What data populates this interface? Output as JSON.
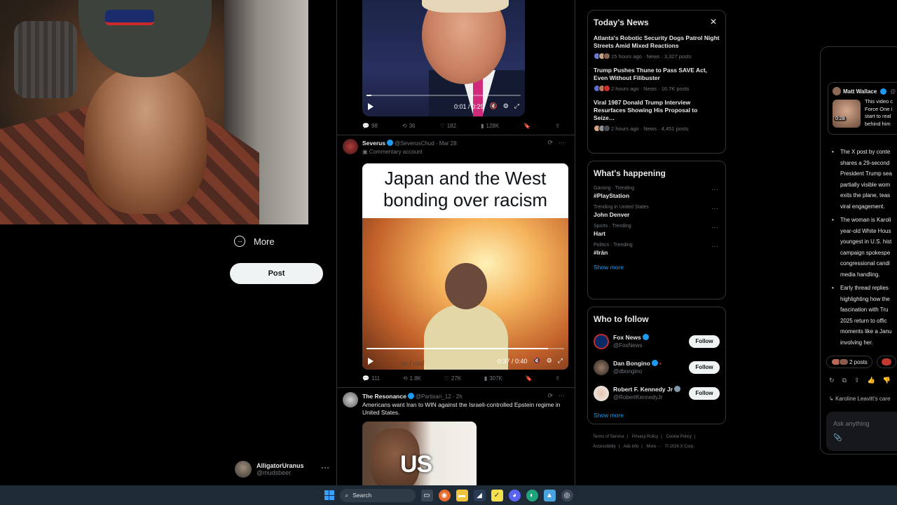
{
  "nav": {
    "more_label": "More",
    "post_label": "Post",
    "account_name": "AlligatorUranus",
    "account_handle": "@mudsbeer"
  },
  "tweet1": {
    "video_time": "0:01 / 0:29",
    "progress": 0.03,
    "replies": "98",
    "reposts": "36",
    "likes": "182",
    "views": "128K"
  },
  "tweet2": {
    "name": "Severus",
    "handle": "@SeverusChud",
    "date": "Mar 28",
    "account_type": "Commentary account",
    "caption": "Japan and the West bonding over racism",
    "subtitle_partial": "no I conf",
    "video_time": "0:37 / 0:40",
    "progress": 0.92,
    "replies": "111",
    "reposts": "1.8K",
    "likes": "27K",
    "views": "307K"
  },
  "tweet3": {
    "name": "The Resonance",
    "handle": "@Partisan_12",
    "date": "2h",
    "text": "Americans want Iran to WIN against the Israeli-controlled Epstein regime in United States.",
    "image_text": "US"
  },
  "todays_news": {
    "title": "Today's News",
    "items": [
      {
        "title": "Atlanta's Robotic Security Dogs Patrol Night Streets Amid Mixed Reactions",
        "meta": "15 hours ago · News · 3,327 posts"
      },
      {
        "title": "Trump Pushes Thune to Pass SAVE Act, Even Without Filibuster",
        "meta": "2 hours ago · News · 16.7K posts"
      },
      {
        "title": "Viral 1987 Donald Trump Interview Resurfaces Showing His Proposal to Seize…",
        "meta": "2 hours ago · News · 4,451 posts"
      }
    ]
  },
  "whats_happening": {
    "title": "What's happening",
    "trends": [
      {
        "context": "Gaming · Trending",
        "name": "#PlayStation"
      },
      {
        "context": "Trending in United States",
        "name": "John Denver"
      },
      {
        "context": "Sports · Trending",
        "name": "Hart"
      },
      {
        "context": "Politics · Trending",
        "name": "#Irán"
      }
    ],
    "show_more": "Show more"
  },
  "who_to_follow": {
    "title": "Who to follow",
    "accounts": [
      {
        "name": "Fox News",
        "handle": "@FoxNews",
        "button": "Follow"
      },
      {
        "name": "Dan Bongino",
        "handle": "@dbongino",
        "button": "Follow"
      },
      {
        "name": "Robert F. Kennedy Jr",
        "handle": "@RobertKennedyJr",
        "button": "Follow"
      }
    ],
    "show_more": "Show more"
  },
  "footer": {
    "links": [
      "Terms of Service",
      "|",
      "Privacy Policy",
      "|",
      "Cookie Policy",
      "|",
      "Accessibility",
      "|",
      "Ads info",
      "|",
      "More ···",
      "© 2026 X Corp."
    ]
  },
  "grok": {
    "quote_name": "Matt Wallace",
    "quote_handle": "@",
    "quote_duration": "0:28",
    "quote_text": [
      "This video c",
      "Force One i",
      "start to real",
      "behind him"
    ],
    "bullets": [
      [
        "The X post by conte",
        "shares a 29-second",
        "President Trump sea",
        "partially visible wom",
        "exits the plane, teas",
        "viral engagement."
      ],
      [
        "The woman is Karoli",
        "year-old White Hous",
        "youngest in U.S. hist",
        "campaign spokespe",
        "congressional candi",
        "media handling."
      ],
      [
        "Early thread replies",
        "highlighting how the",
        "fascination with Tru",
        "2025 return to offic",
        "moments like a Janu",
        "involving her."
      ]
    ],
    "chip1": "2 posts",
    "suggestion": "Karoline Leavitt's care",
    "ask_placeholder": "Ask anything"
  },
  "taskbar": {
    "search_label": "Search"
  },
  "colors": {
    "accent": "#1d9bf0",
    "background": "#000000",
    "border": "#2f3336",
    "muted": "#71767b"
  }
}
